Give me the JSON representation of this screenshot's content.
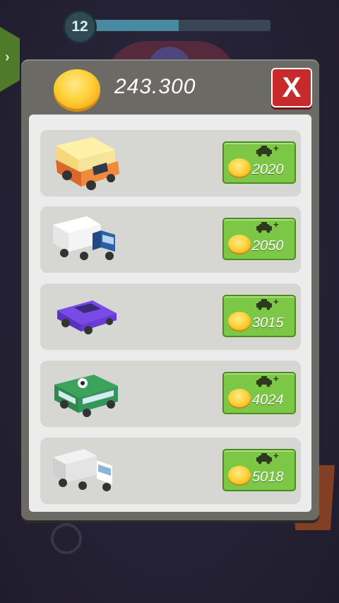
{
  "level": {
    "number": "12",
    "progress_fraction": 0.49
  },
  "shop": {
    "balance": "243.300",
    "close_label": "X",
    "items": [
      {
        "vehicle": "camper-van",
        "price": "2020",
        "color": "#f08a3c"
      },
      {
        "vehicle": "box-truck-blue-cab",
        "price": "2050",
        "color": "#2b5fa8"
      },
      {
        "vehicle": "purple-sedan",
        "price": "3015",
        "color": "#6a3ad6"
      },
      {
        "vehicle": "green-minibus",
        "price": "4024",
        "color": "#2e8a4c"
      },
      {
        "vehicle": "white-delivery-truck",
        "price": "5018",
        "color": "#d9d9d9"
      }
    ]
  },
  "colors": {
    "buy_button": "#7cc745",
    "close_button": "#c72a2a",
    "panel": "#6c6a65"
  }
}
